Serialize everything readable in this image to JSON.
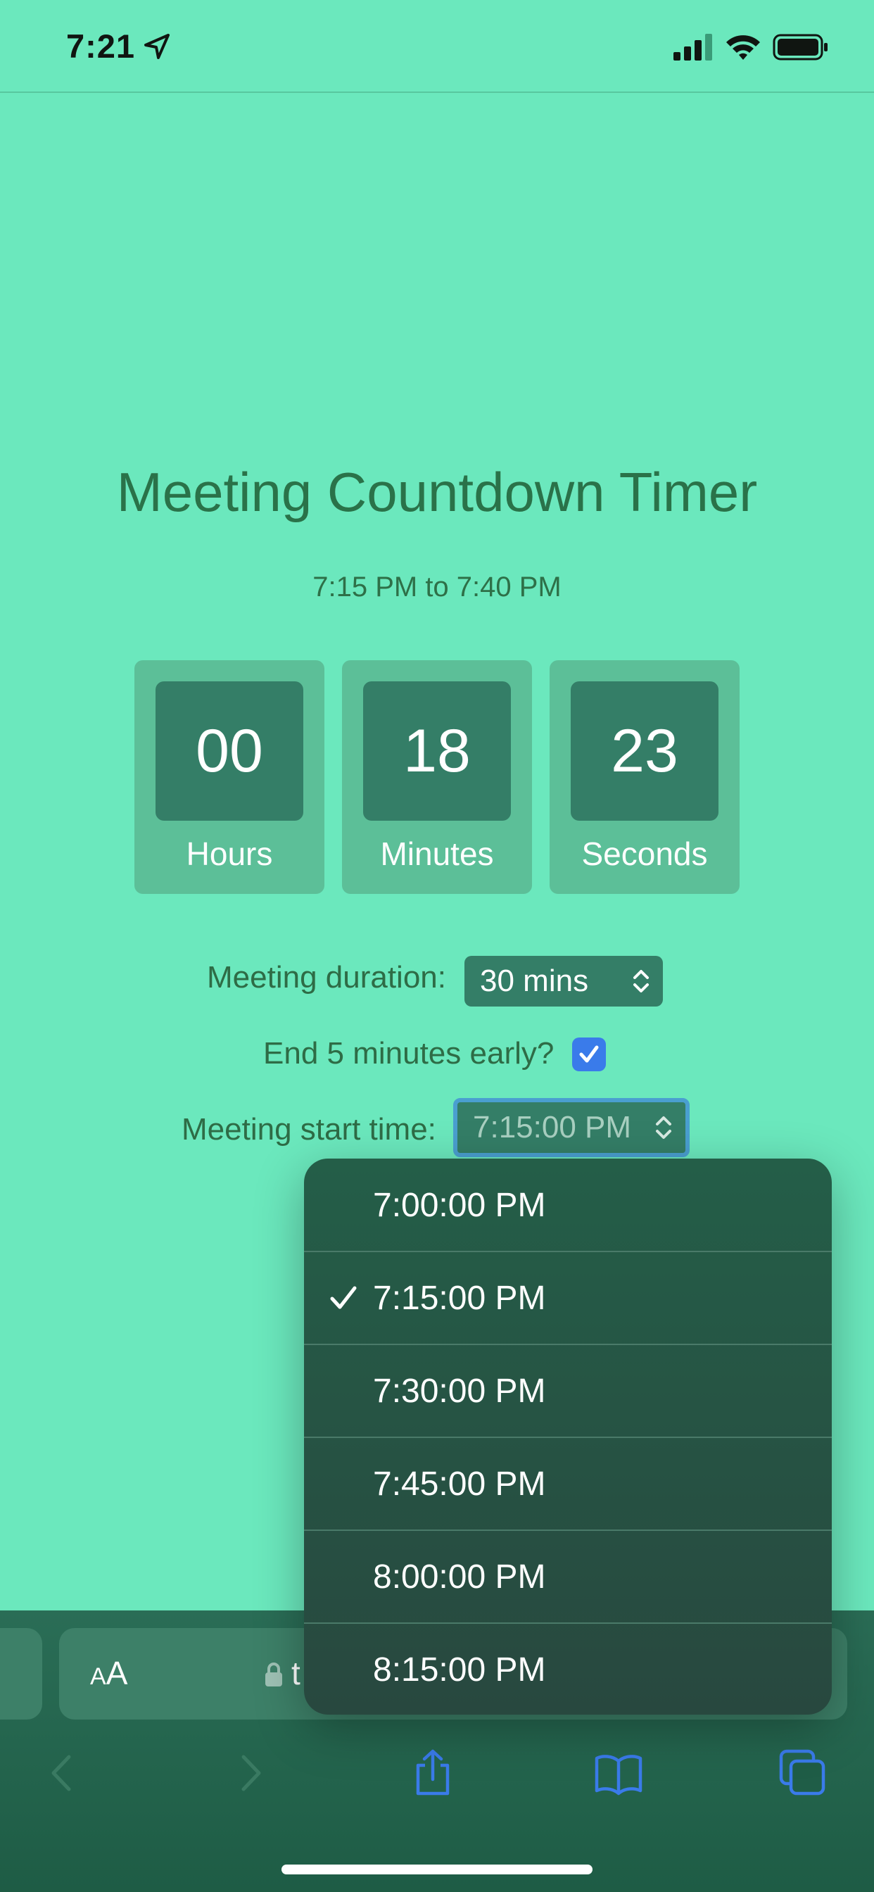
{
  "status_bar": {
    "time": "7:21"
  },
  "page": {
    "title": "Meeting Countdown Timer",
    "range": "7:15 PM to 7:40 PM"
  },
  "timer": [
    {
      "value": "00",
      "label": "Hours"
    },
    {
      "value": "18",
      "label": "Minutes"
    },
    {
      "value": "23",
      "label": "Seconds"
    }
  ],
  "form": {
    "duration_label": "Meeting duration:",
    "duration_value": "30 mins",
    "early_label": "End 5 minutes early?",
    "early_checked": true,
    "start_label": "Meeting start time:",
    "start_value": "7:15:00 PM"
  },
  "dropdown": {
    "options": [
      {
        "label": "7:00:00 PM",
        "selected": false
      },
      {
        "label": "7:15:00 PM",
        "selected": true
      },
      {
        "label": "7:30:00 PM",
        "selected": false
      },
      {
        "label": "7:45:00 PM",
        "selected": false
      },
      {
        "label": "8:00:00 PM",
        "selected": false
      },
      {
        "label": "8:15:00 PM",
        "selected": false
      }
    ]
  },
  "browser": {
    "aa_small": "A",
    "aa_large": "A",
    "url_partial": "t"
  },
  "icons": {
    "location": "location-arrow-icon",
    "signal": "cellular-signal-icon",
    "wifi": "wifi-icon",
    "battery": "battery-icon",
    "back": "chevron-left-icon",
    "forward": "chevron-right-icon",
    "share": "share-icon",
    "bookmarks": "book-icon",
    "tabs": "tabs-icon"
  },
  "colors": {
    "background": "#6be8bd",
    "title": "#2a7249",
    "timer_box": "#5cbf98",
    "timer_value_box": "#347e67",
    "select": "#347e67",
    "checkbox": "#3a7bea",
    "dropdown": "#245e48",
    "toolbar_icon": "#3a7bea"
  }
}
